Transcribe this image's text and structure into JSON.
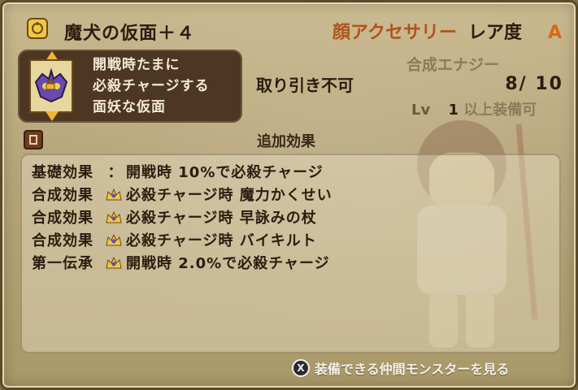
{
  "header": {
    "item_name": "魔犬の仮面＋４",
    "equip_type": "顔アクセサリー",
    "rarity_label": "レア度",
    "rarity_value": "A"
  },
  "info": {
    "lines": [
      "開戦時たまに",
      "必殺チャージする",
      "面妖な仮面"
    ]
  },
  "trade": {
    "status": "取り引き不可"
  },
  "synthesis": {
    "title": "合成エナジー",
    "value": "8/ 10",
    "lv_label": "Lv",
    "lv_value": "1",
    "lv_text": "以上装備可"
  },
  "effects_section": {
    "title": "追加効果",
    "rows": [
      {
        "label": "基礎効果",
        "sep": "：",
        "text": "開戦時 10%で必殺チャージ",
        "crown": false
      },
      {
        "label": "合成効果",
        "sep": "",
        "text": "必殺チャージ時 魔力かくせい",
        "crown": true
      },
      {
        "label": "合成効果",
        "sep": "",
        "text": "必殺チャージ時 早詠みの杖",
        "crown": true
      },
      {
        "label": "合成効果",
        "sep": "",
        "text": "必殺チャージ時 バイキルト",
        "crown": true
      },
      {
        "label": "第一伝承",
        "sep": "",
        "text": "開戦時 2.0%で必殺チャージ",
        "crown": true
      }
    ]
  },
  "footer": {
    "button": "X",
    "text": "装備できる仲間モンスターを見る"
  },
  "colors": {
    "accent_orange": "#b1531a",
    "rarity_orange": "#d86a12",
    "dark_text": "#2c1c0f",
    "info_box": "#4d3723"
  }
}
